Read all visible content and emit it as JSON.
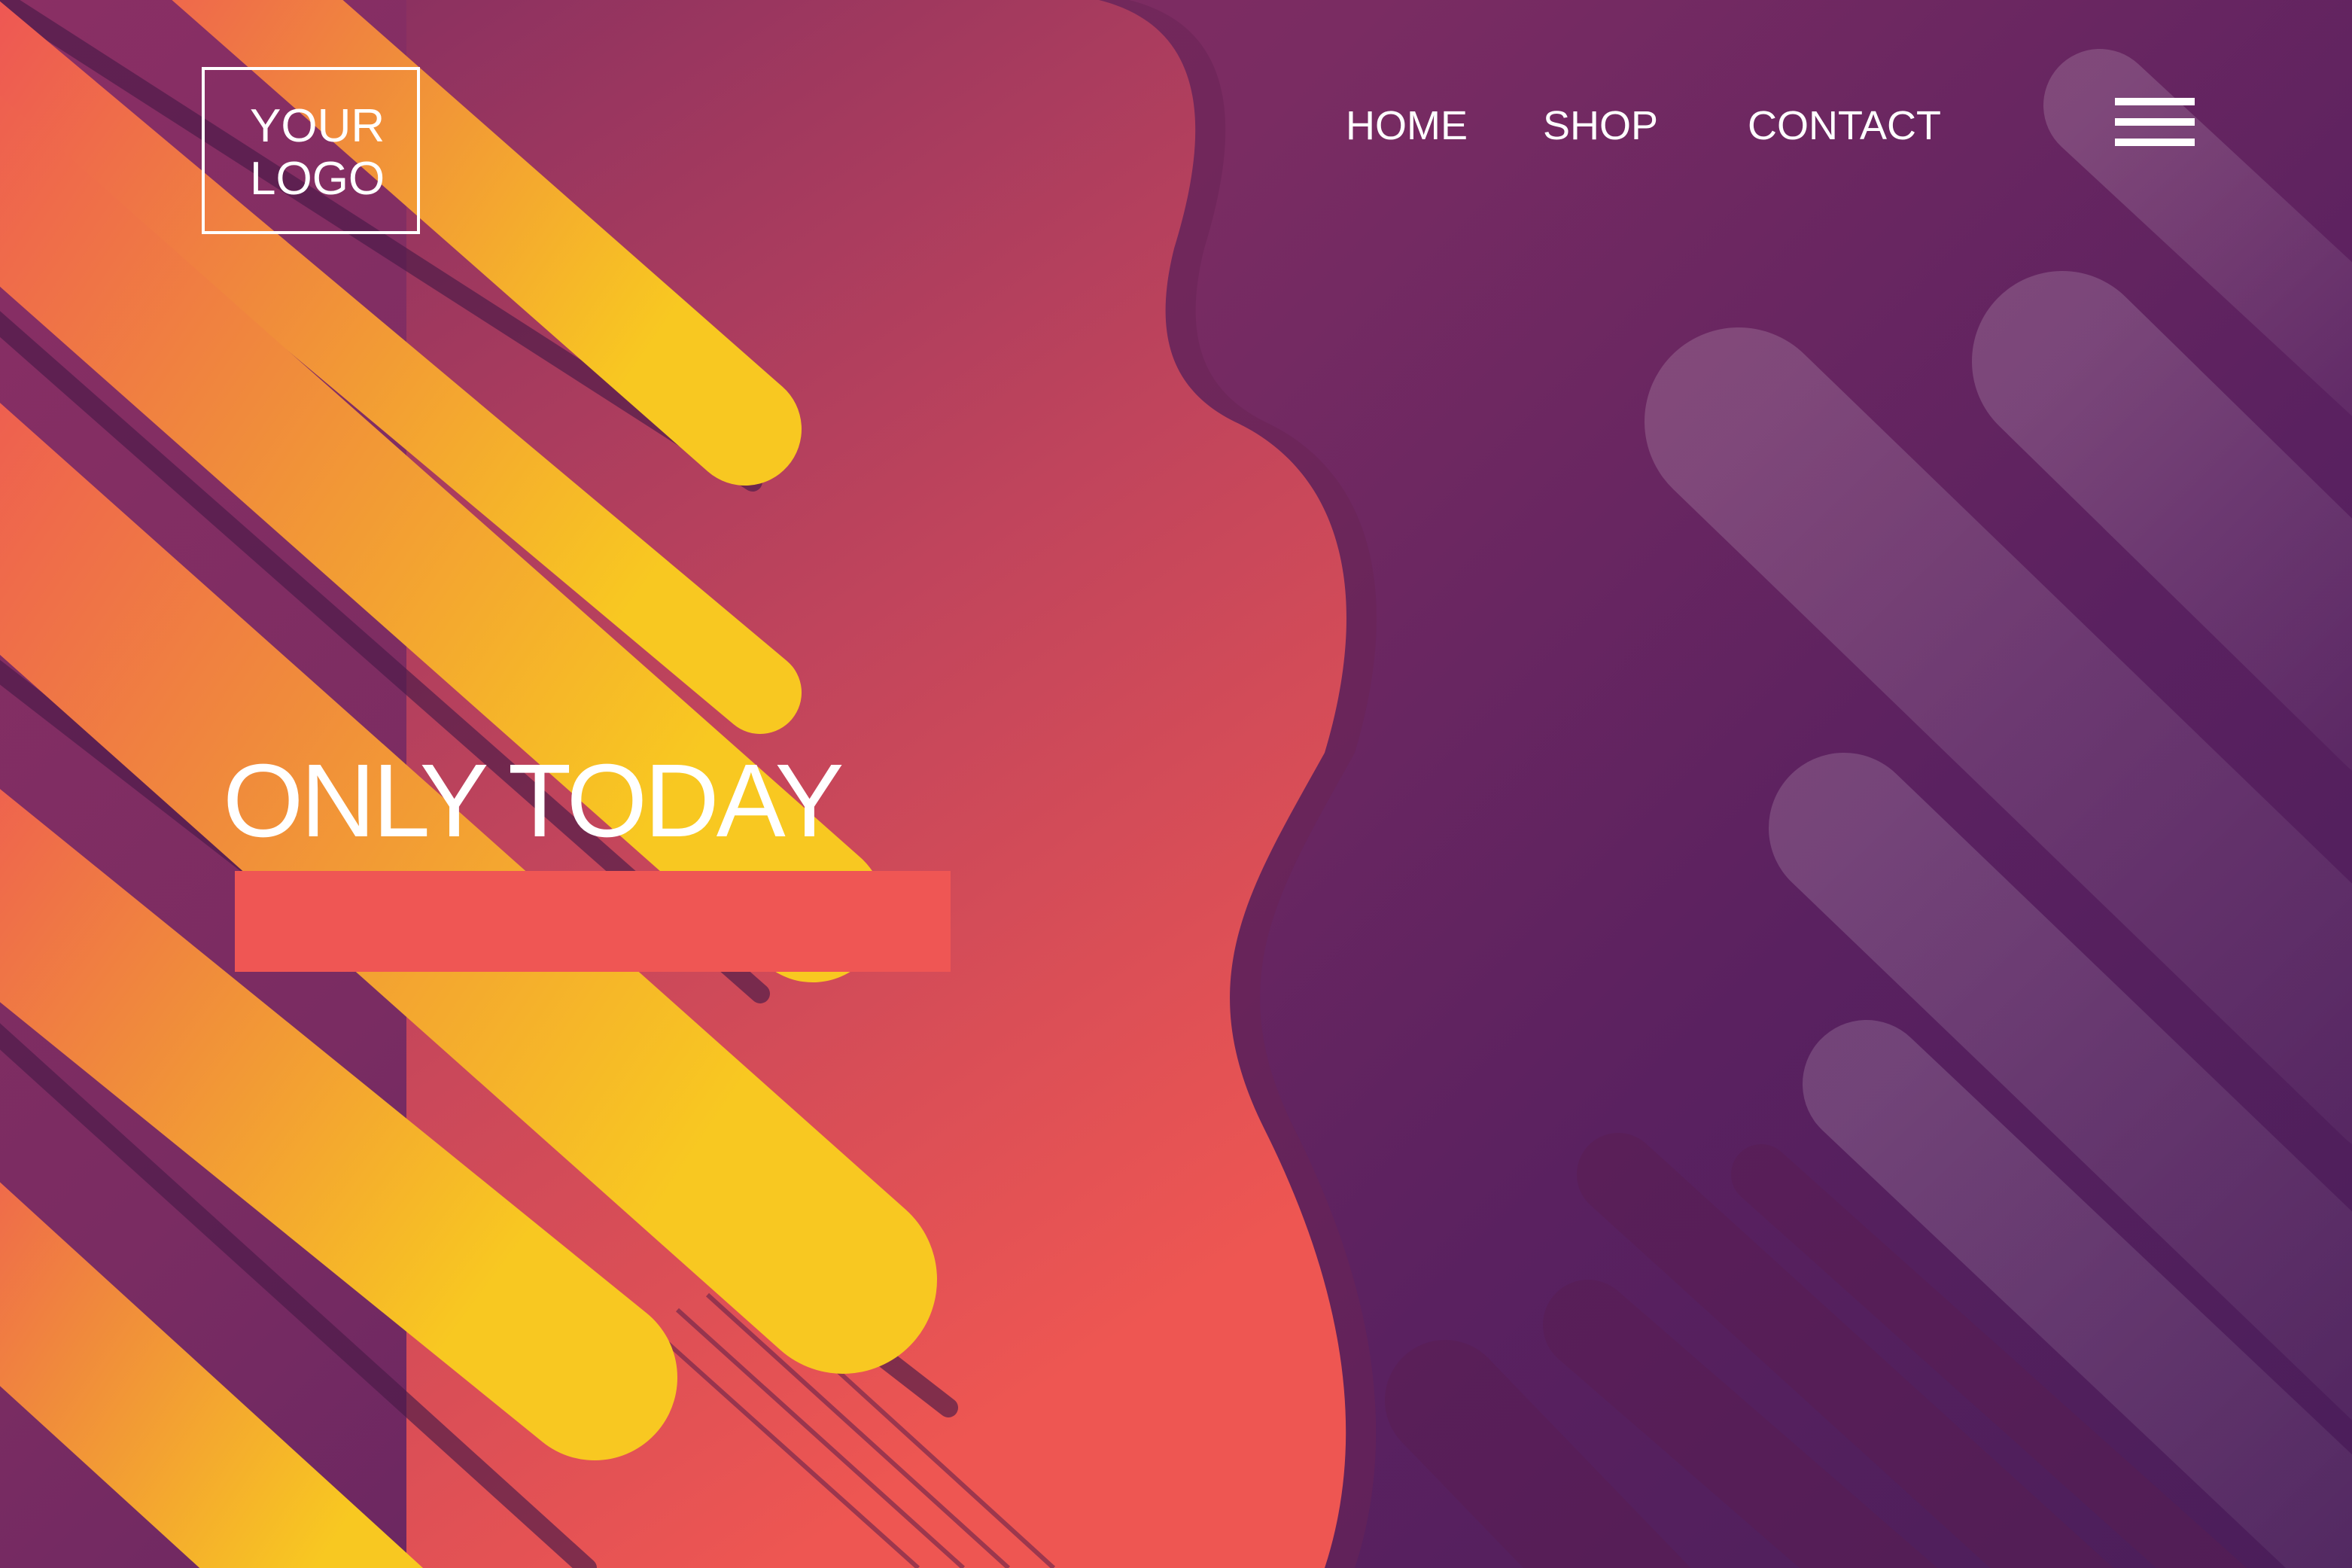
{
  "logo": {
    "lines": [
      "YOUR",
      "LOGO"
    ]
  },
  "nav": {
    "items": [
      "HOME",
      "SHOP",
      "CONTACT"
    ]
  },
  "menu": {
    "icon": "hamburger-menu-icon"
  },
  "hero": {
    "headline": "ONLY TODAY"
  },
  "colors": {
    "orange": "#f0843e",
    "yellow": "#f7c523",
    "coral": "#ef5654",
    "purple": "#5a2160",
    "magenta": "#8a2f64"
  }
}
